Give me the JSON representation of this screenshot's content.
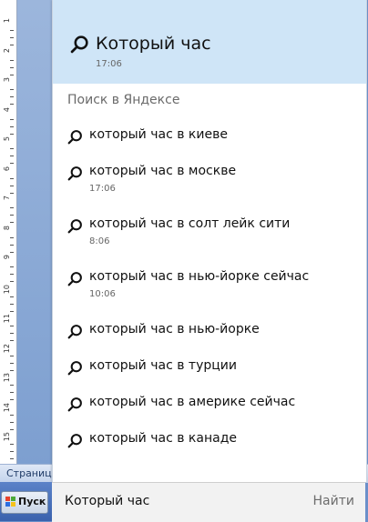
{
  "background": {
    "ruler_numbers": [
      "1",
      "2",
      "3",
      "4",
      "5",
      "6",
      "7",
      "8",
      "9",
      "10",
      "11",
      "12",
      "13",
      "14",
      "15"
    ],
    "status_text": "Страница"
  },
  "popup": {
    "top_result": {
      "title": "Который час",
      "subtitle": "17:06"
    },
    "section_heading": "Поиск в Яндексе",
    "items": [
      {
        "label": "который час в киеве",
        "time": ""
      },
      {
        "label": "который час в москве",
        "time": "17:06"
      },
      {
        "label": "который час в солт лейк сити",
        "time": "8:06"
      },
      {
        "label": "который час в нью-йорке сейчас",
        "time": "10:06"
      },
      {
        "label": "который час в нью-йорке",
        "time": ""
      },
      {
        "label": "который час в турции",
        "time": ""
      },
      {
        "label": "который час в америке сейчас",
        "time": ""
      },
      {
        "label": "который час в канаде",
        "time": ""
      }
    ]
  },
  "searchbar": {
    "value": "Который час",
    "find_label": "Найти"
  },
  "taskbar": {
    "start_label": "Пуск"
  },
  "colors": {
    "top_result_bg": "#cfe5f7",
    "taskbar_blue": "#3a62ad"
  }
}
